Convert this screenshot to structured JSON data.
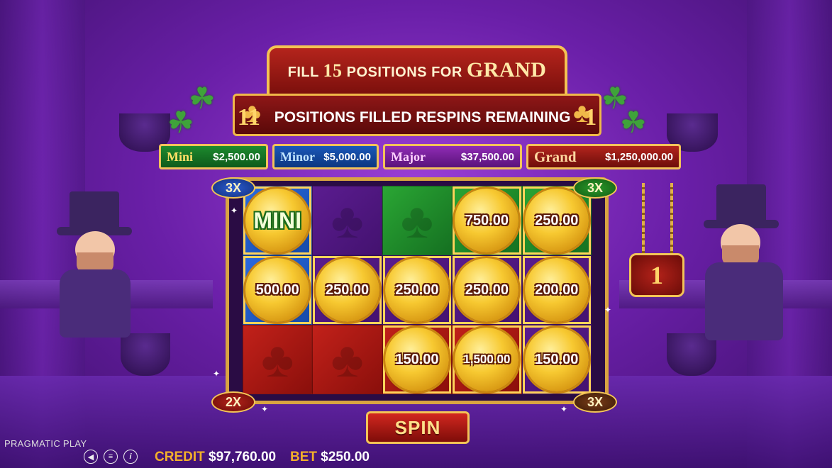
{
  "header": {
    "fill_prefix": "FILL",
    "fill_count": "15",
    "fill_mid": "POSITIONS FOR",
    "fill_target": "GRAND",
    "filled_count": "11",
    "status_label": "POSITIONS FILLED RESPINS REMAINING",
    "respins_remaining": "1"
  },
  "jackpots": [
    {
      "name": "Mini",
      "value": "$2,500.00"
    },
    {
      "name": "Minor",
      "value": "$5,000.00"
    },
    {
      "name": "Major",
      "value": "$37,500.00"
    },
    {
      "name": "Grand",
      "value": "$1,250,000.00"
    }
  ],
  "multipliers": {
    "top_left": "3X",
    "top_right": "3X",
    "bottom_left": "2X",
    "bottom_right": "3X"
  },
  "grid": {
    "rows": [
      [
        {
          "bg": "blue",
          "coin": true,
          "label": "MINI",
          "kind": "mini"
        },
        {
          "bg": "purple",
          "coin": false,
          "label": ""
        },
        {
          "bg": "green",
          "coin": false,
          "label": ""
        },
        {
          "bg": "green",
          "coin": true,
          "label": "750.00"
        },
        {
          "bg": "green",
          "coin": true,
          "label": "250.00"
        }
      ],
      [
        {
          "bg": "blue",
          "coin": true,
          "label": "500.00"
        },
        {
          "bg": "purple",
          "coin": true,
          "label": "250.00"
        },
        {
          "bg": "purple",
          "coin": true,
          "label": "250.00"
        },
        {
          "bg": "purple",
          "coin": true,
          "label": "250.00"
        },
        {
          "bg": "purple",
          "coin": true,
          "label": "200.00"
        }
      ],
      [
        {
          "bg": "red",
          "coin": false,
          "label": ""
        },
        {
          "bg": "red",
          "coin": false,
          "label": ""
        },
        {
          "bg": "red",
          "coin": true,
          "label": "150.00"
        },
        {
          "bg": "red",
          "coin": true,
          "label": "1,500.00",
          "kind": "small"
        },
        {
          "bg": "purple",
          "coin": true,
          "label": "150.00"
        }
      ]
    ]
  },
  "respin_badge": "1",
  "spin_label": "SPIN",
  "footer": {
    "brand": "PRAGMATIC PLAY",
    "credit_label": "CREDIT",
    "credit_value": "$97,760.00",
    "bet_label": "BET",
    "bet_value": "$250.00",
    "icons": [
      "sound-icon",
      "menu-icon",
      "info-icon"
    ]
  },
  "colors": {
    "accent_gold": "#f2c457",
    "sign_red": "#b4241c",
    "bg_purple": "#6a1fa8"
  }
}
